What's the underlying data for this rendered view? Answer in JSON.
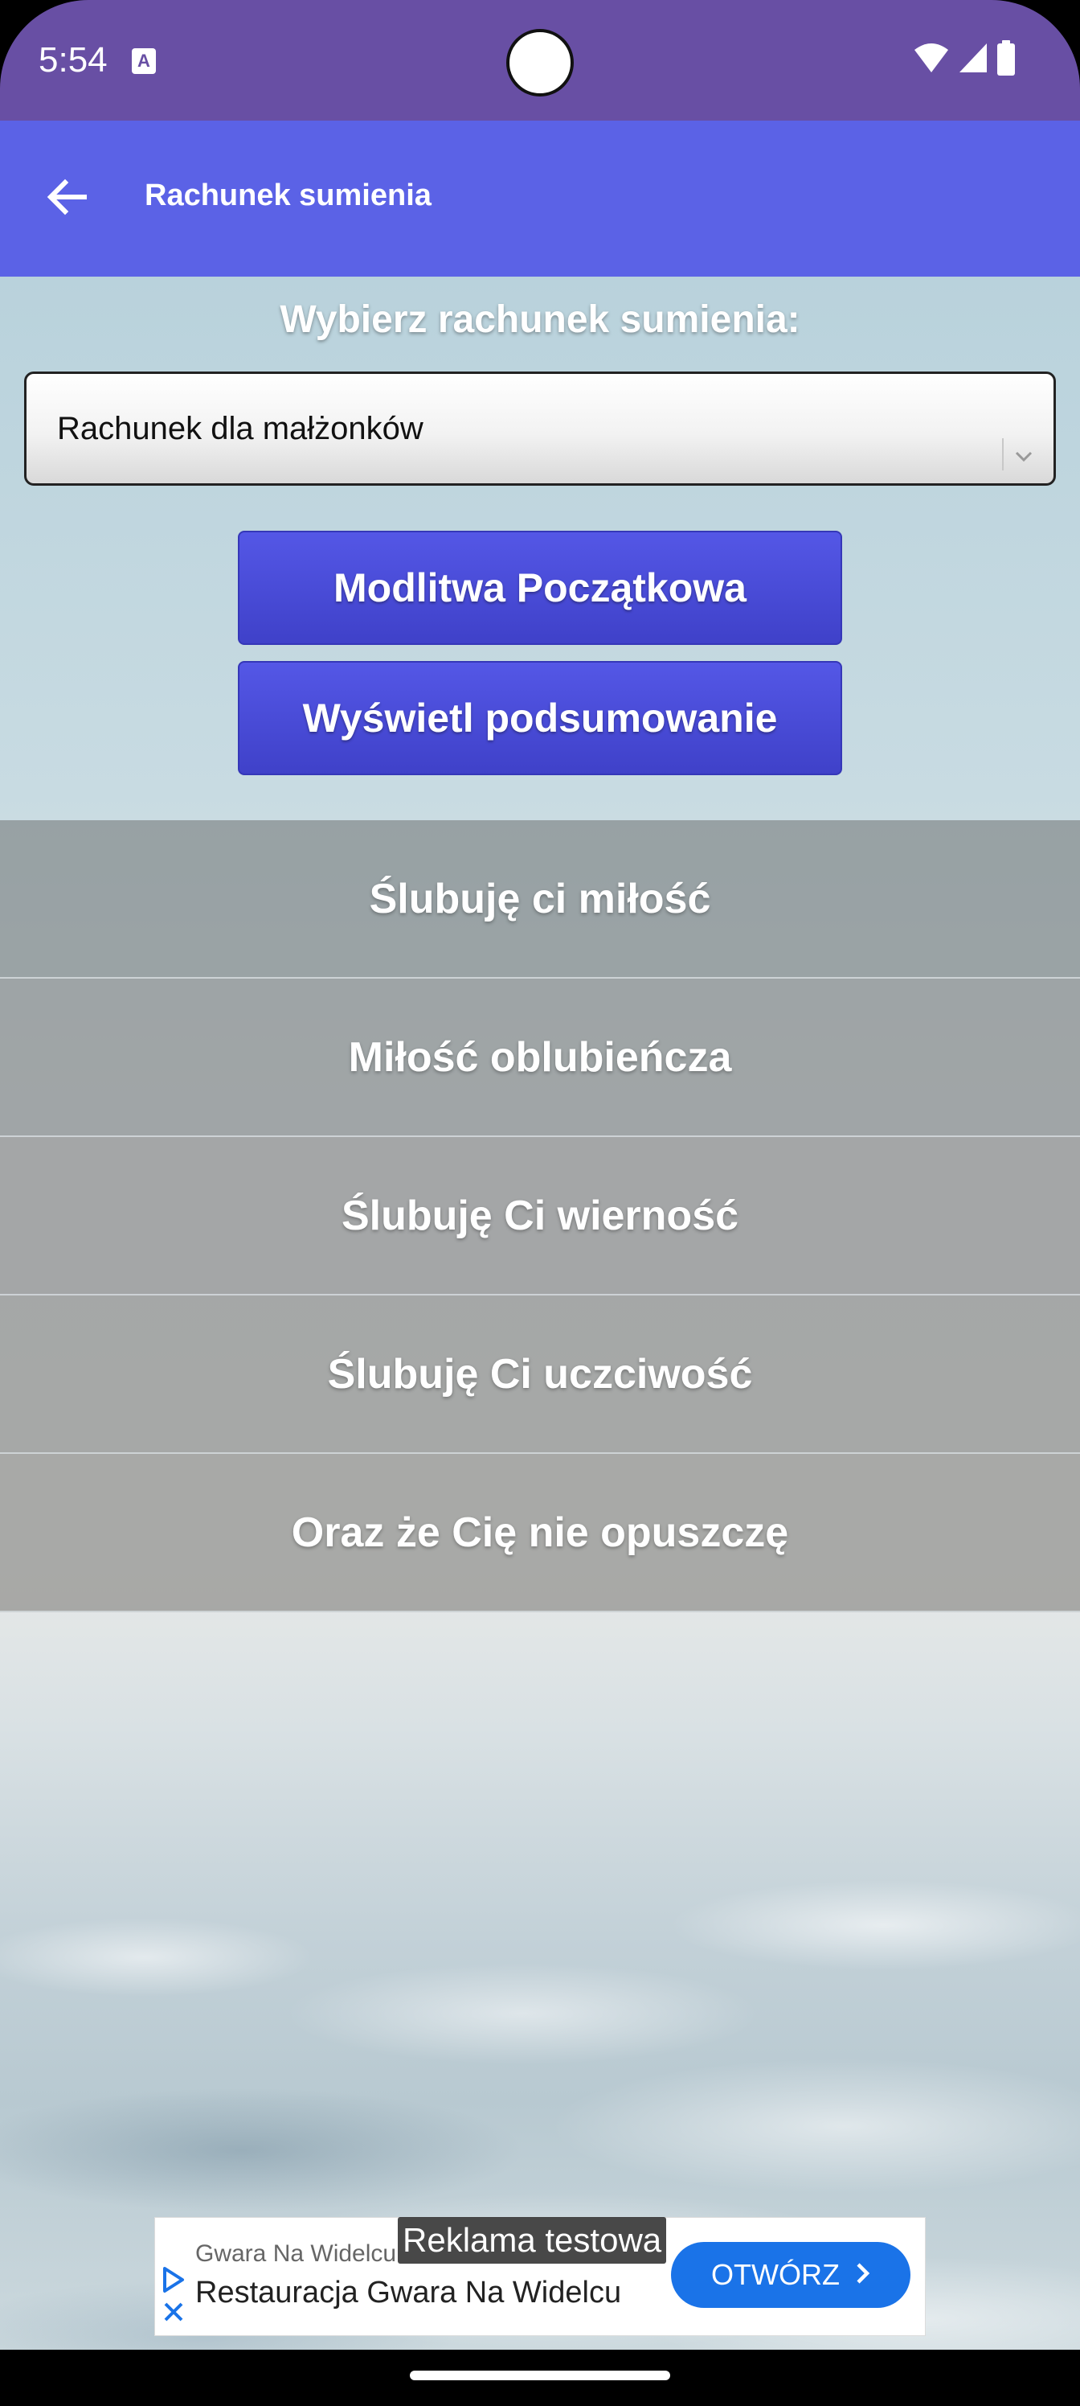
{
  "status_bar": {
    "time": "5:54",
    "notification_icon": "a-icon",
    "icons": [
      "wifi-icon",
      "cellular-signal-icon",
      "battery-icon"
    ]
  },
  "app_bar": {
    "title": "Rachunek sumienia",
    "back_icon": "arrow-back-icon",
    "color": "#5b62e6"
  },
  "main": {
    "prompt": "Wybierz rachunek sumienia:",
    "dropdown": {
      "selected": "Rachunek dla małżonków",
      "icon": "chevron-down-icon"
    },
    "buttons": {
      "opening_prayer": "Modlitwa Początkowa",
      "show_summary": "Wyświetl podsumowanie"
    },
    "button_color": "#4446d6",
    "sections": [
      "Ślubuję ci miłość",
      "Miłość oblubieńcza",
      "Ślubuję Ci wierność",
      "Ślubuję Ci uczciwość",
      "Oraz że Cię nie opuszczę"
    ]
  },
  "ad": {
    "test_label": "Reklama testowa",
    "advertiser": "Gwara Na Widelcu",
    "headline": "Restauracja Gwara Na Widelcu",
    "cta": "OTWÓRZ",
    "cta_color": "#1a73e8"
  },
  "colors": {
    "status_bar": "#684fa4"
  }
}
